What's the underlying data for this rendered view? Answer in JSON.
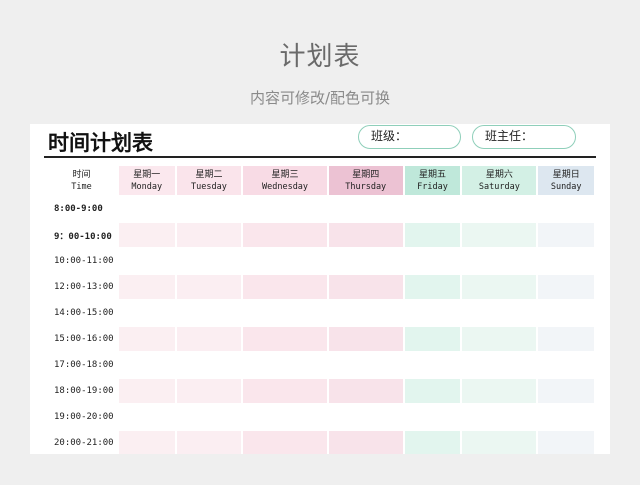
{
  "header": {
    "title": "计划表",
    "subtitle": "内容可修改/配色可换"
  },
  "sheet": {
    "title": "时间计划表",
    "class_label": "班级：",
    "teacher_label": "班主任：",
    "time_header": {
      "cn": "时间",
      "en": "Time"
    },
    "days": [
      {
        "cn": "星期一",
        "en": "Monday"
      },
      {
        "cn": "星期二",
        "en": "Tuesday"
      },
      {
        "cn": "星期三",
        "en": "Wednesday"
      },
      {
        "cn": "星期四",
        "en": "Thursday"
      },
      {
        "cn": "星期五",
        "en": "Friday"
      },
      {
        "cn": "星期六",
        "en": "Saturday"
      },
      {
        "cn": "星期日",
        "en": "Sunday"
      }
    ],
    "times": [
      "8:00-9:00",
      "9：00-10:00",
      "10:00-11:00",
      "12:00-13:00",
      "14:00-15:00",
      "15:00-16:00",
      "17:00-18:00",
      "18:00-19:00",
      "19:00-20:00",
      "20:00-21:00"
    ]
  },
  "colors": {
    "accent_border": "#8fcfba",
    "background": "#efefef",
    "header_thursday": "#ecc2d3",
    "header_friday": "#bfe8da"
  }
}
